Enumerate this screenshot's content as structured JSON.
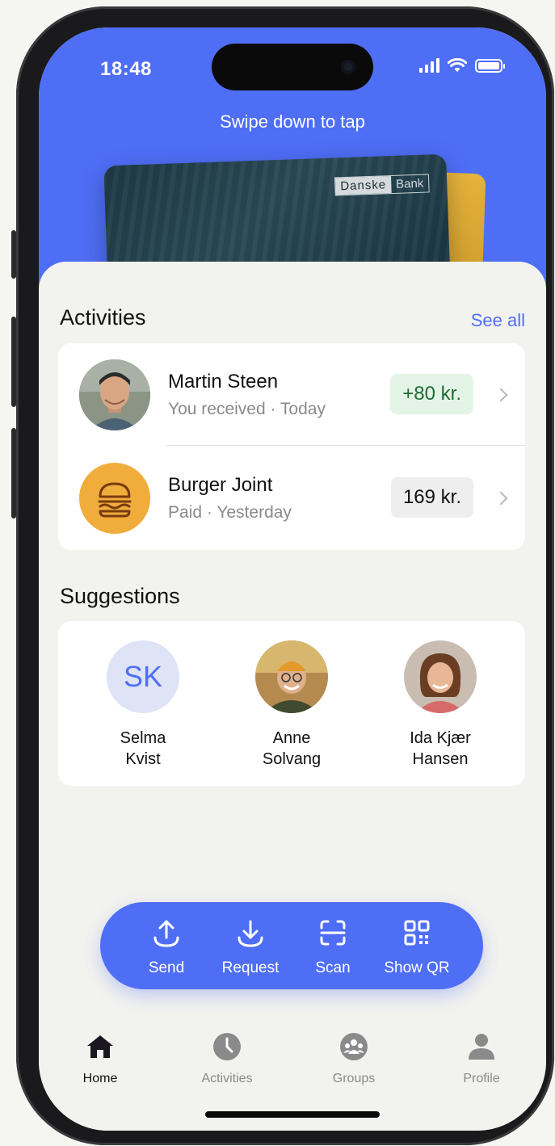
{
  "status": {
    "time": "18:48"
  },
  "hero": {
    "swipe_hint": "Swipe down to tap",
    "card_brand_1": "Danske",
    "card_brand_2": "Bank"
  },
  "activities": {
    "title": "Activities",
    "see_all": "See all",
    "items": [
      {
        "name": "Martin Steen",
        "subtitle": "You received · Today",
        "amount": "+80 kr.",
        "amount_bg": "#e3f4e7",
        "amount_color": "#1f6a33"
      },
      {
        "name": "Burger Joint",
        "subtitle": "Paid · Yesterday",
        "amount": "169 kr.",
        "amount_bg": "#eeeeee",
        "amount_color": "#111111"
      }
    ]
  },
  "suggestions": {
    "title": "Suggestions",
    "people": [
      {
        "initials": "SK",
        "line1": "Selma",
        "line2": "Kvist"
      },
      {
        "line1": "Anne",
        "line2": "Solvang"
      },
      {
        "line1": "Ida Kjær",
        "line2": "Hansen"
      }
    ]
  },
  "actions": [
    {
      "label": "Send",
      "icon": "upload-icon"
    },
    {
      "label": "Request",
      "icon": "download-icon"
    },
    {
      "label": "Scan",
      "icon": "scan-icon"
    },
    {
      "label": "Show QR",
      "icon": "qr-icon"
    }
  ],
  "tabs": [
    {
      "label": "Home",
      "icon": "home-icon",
      "active": true
    },
    {
      "label": "Activities",
      "icon": "clock-icon"
    },
    {
      "label": "Groups",
      "icon": "groups-icon"
    },
    {
      "label": "Profile",
      "icon": "person-icon"
    }
  ],
  "colors": {
    "accent": "#4f6ef6",
    "burger_bg": "#f0ad3c",
    "sk_bg": "#dfe3f6",
    "sk_text": "#4f6ef6"
  }
}
